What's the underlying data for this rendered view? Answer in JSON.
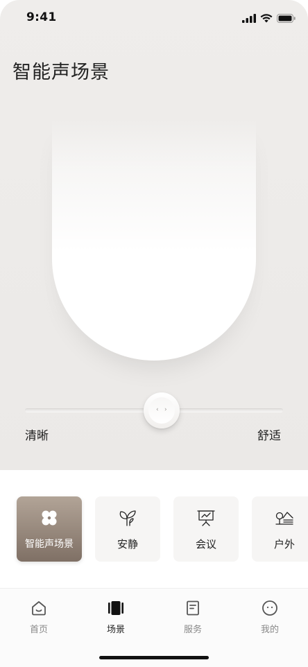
{
  "status_bar": {
    "time": "9:41",
    "icons": [
      "signal-icon",
      "wifi-icon",
      "battery-icon"
    ]
  },
  "page": {
    "title": "智能声场景"
  },
  "slider": {
    "left_label": "清晰",
    "right_label": "舒适",
    "value_percent": 54
  },
  "scenes": [
    {
      "label": "智能声场景",
      "icon": "four-petal-icon",
      "active": true
    },
    {
      "label": "安静",
      "icon": "sprout-icon",
      "active": false
    },
    {
      "label": "会议",
      "icon": "presentation-board-icon",
      "active": false
    },
    {
      "label": "户外",
      "icon": "tree-mountain-icon",
      "active": false
    }
  ],
  "tabs": [
    {
      "label": "首页",
      "icon": "home-icon",
      "active": false
    },
    {
      "label": "场景",
      "icon": "scene-icon",
      "active": true
    },
    {
      "label": "服务",
      "icon": "document-icon",
      "active": false
    },
    {
      "label": "我的",
      "icon": "profile-icon",
      "active": false
    }
  ],
  "colors": {
    "background": "#ecebe9",
    "active_card_gradient_top": "#b2a497",
    "active_card_gradient_bottom": "#7f7065",
    "text_primary": "#222222",
    "text_secondary": "#888888"
  }
}
